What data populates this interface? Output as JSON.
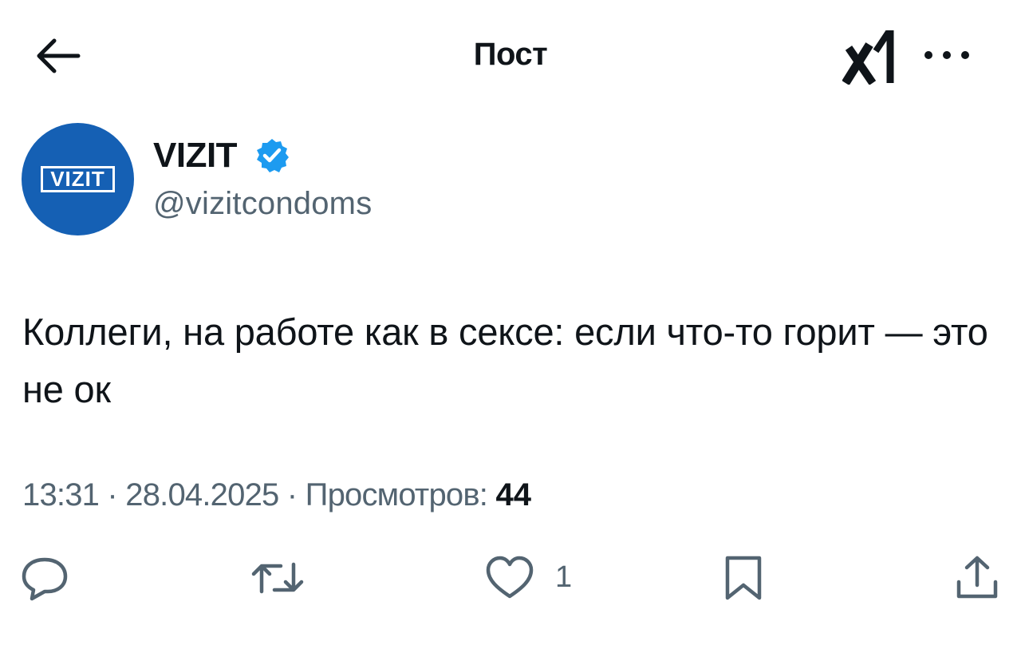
{
  "header": {
    "title": "Пост",
    "back_icon": "arrow-left-icon",
    "grok_icon": "grok-logo-icon",
    "more_icon": "more-horizontal-icon"
  },
  "author": {
    "avatar_text": "VIZIT",
    "avatar_color": "#1560b4",
    "name": "VIZIT",
    "verified_color": "#1d9bf0",
    "handle": "@vizitcondoms"
  },
  "post": {
    "text": "Коллеги, на работе как в сексе: если что-то горит — это не ок"
  },
  "meta": {
    "time": "13:31",
    "separator": " · ",
    "date": "28.04.2025",
    "views_label": "Просмотров:",
    "views_count": "44"
  },
  "actions": {
    "like_count": "1"
  },
  "colors": {
    "text_primary": "#0f1419",
    "text_secondary": "#536471"
  }
}
